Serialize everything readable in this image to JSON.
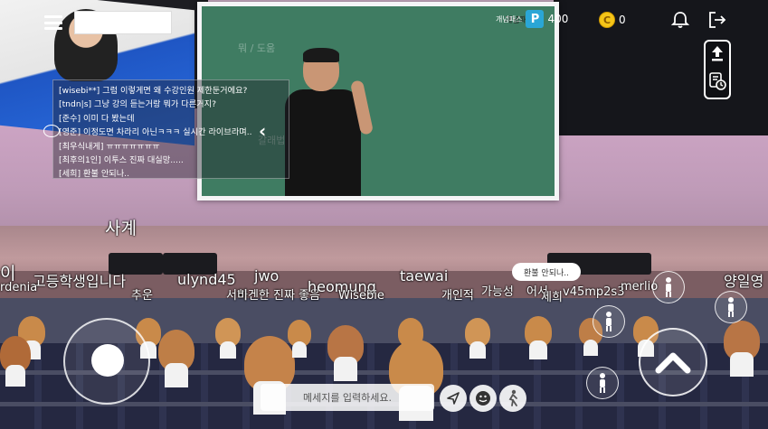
{
  "header": {
    "brand": "개념패스",
    "points_badge": "P",
    "points": "400",
    "coins_badge": "C",
    "coins": "0"
  },
  "screen": {
    "chalk_1": "뭐 / 도움",
    "chalk_2": "갈래법",
    "logo": "개념패스"
  },
  "chat": {
    "messages": [
      "[wisebi**] 그럼 이렇게면 왜 수강인원 제한둔거에요?",
      "[tndn|s] 그냥 강의 듣는거랑 뭐가 다른거지?",
      "[준수] 이미 다 봤는데",
      "[영준] 이정도면 차라리 아닌ㅋㅋㅋ 실시간 라이브라며..",
      "[최우식내게] ㅠㅠㅠㅠㅠㅠㅠ",
      "[최후의1인] 이투스 진짜 대실망.....",
      "[세희] 환불 안되나.."
    ]
  },
  "nicknames": [
    "사계",
    "이",
    "고등학생입니다",
    "rdenia",
    "추운",
    "ulynd45",
    "서하",
    "jwo",
    "비겐한 진짜 좋음",
    "heomung",
    "Wisebie",
    "taewai",
    "개인적",
    "가능성",
    "어서",
    "세희",
    "v45mp2s3",
    "merlio",
    "양일영"
  ],
  "speech_bubble": "환불 안되나..",
  "input": {
    "placeholder": "메세지를 입력하세요."
  },
  "icons": {
    "menu": "menu-icon",
    "bell": "bell-icon",
    "exit": "exit-icon",
    "upload": "upload-icon",
    "record": "record-icon",
    "chat": "chat-bubble-icon",
    "send": "send-icon",
    "emoji": "smiley-icon",
    "pose": "pose-icon",
    "jump": "chevron-up-icon"
  },
  "colors": {
    "points_badge": "#2aa6d6",
    "coin_badge": "#f5c518",
    "board": "#3f7c62"
  }
}
